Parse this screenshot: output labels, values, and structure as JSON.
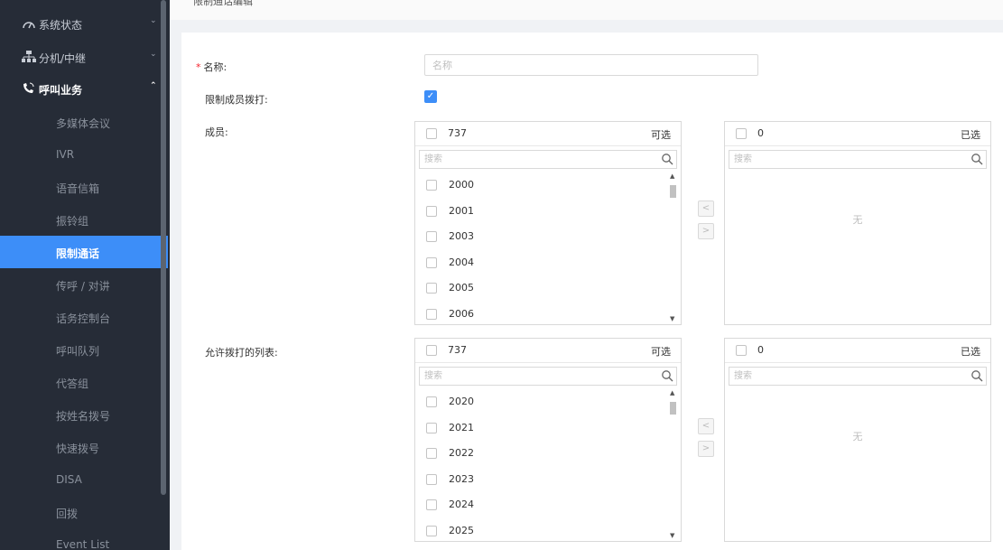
{
  "topbar": {
    "title": "限制通话编辑"
  },
  "sidebar": {
    "groups": [
      {
        "label": "系统状态",
        "icon": "gauge-icon"
      },
      {
        "label": "分机/中继",
        "icon": "network-icon"
      },
      {
        "label": "呼叫业务",
        "icon": "phone-call-icon"
      }
    ],
    "items": [
      {
        "label": "多媒体会议"
      },
      {
        "label": "IVR"
      },
      {
        "label": "语音信箱"
      },
      {
        "label": "振铃组"
      },
      {
        "label": "限制通话",
        "active": true
      },
      {
        "label": "传呼 / 对讲"
      },
      {
        "label": "话务控制台"
      },
      {
        "label": "呼叫队列"
      },
      {
        "label": "代答组"
      },
      {
        "label": "按姓名拨号"
      },
      {
        "label": "快速拨号"
      },
      {
        "label": "DISA"
      },
      {
        "label": "回拨"
      },
      {
        "label": "Event List"
      }
    ]
  },
  "form": {
    "name_label": "名称:",
    "name_placeholder": "名称",
    "restrict_label": "限制成员拨打:",
    "restrict_checked": true,
    "members_label": "成员:",
    "allowed_label": "允许拨打的列表:"
  },
  "members": {
    "available": {
      "count": "737",
      "title": "可选",
      "search_placeholder": "搜索",
      "items": [
        "2000",
        "2001",
        "2003",
        "2004",
        "2005",
        "2006"
      ]
    },
    "selected": {
      "count": "0",
      "title": "已选",
      "search_placeholder": "搜索",
      "empty": "无"
    }
  },
  "allowed": {
    "available": {
      "count": "737",
      "title": "可选",
      "search_placeholder": "搜索",
      "items": [
        "2020",
        "2021",
        "2022",
        "2023",
        "2024",
        "2025"
      ]
    },
    "selected": {
      "count": "0",
      "title": "已选",
      "search_placeholder": "搜索",
      "empty": "无"
    }
  },
  "colors": {
    "sidebar_bg": "#262c37",
    "accent": "#3d8ef8",
    "required": "#f5222d"
  },
  "transfer_buttons": {
    "left": "<",
    "right": ">"
  }
}
